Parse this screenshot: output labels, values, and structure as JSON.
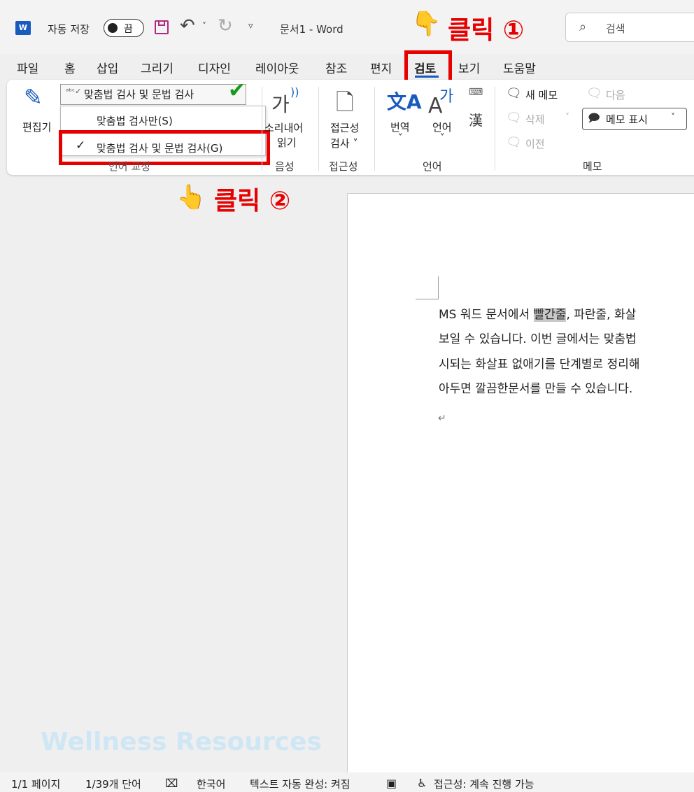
{
  "titlebar": {
    "app_icon": "W",
    "autosave_label": "자동 저장",
    "autosave_state": "끔",
    "doc_title": "문서1  -  Word",
    "search_placeholder": "검색"
  },
  "tabs": [
    "파일",
    "홈",
    "삽입",
    "그리기",
    "디자인",
    "레이아웃",
    "참조",
    "편지",
    "검토",
    "보기",
    "도움말"
  ],
  "active_tab": "검토",
  "ribbon": {
    "editor_label": "편집기",
    "spelling_combo": "맞춤법 검사 및 문법 검사",
    "menu_spelling_only": "맞춤법 검사만(S)",
    "menu_spelling_grammar": "맞춤법 검사 및 문법 검사(G)",
    "proofing_group": "언어 교정",
    "read_aloud_glyph": "가",
    "read_aloud_line1": "소리내어",
    "read_aloud_line2": "읽기",
    "speech_group": "음성",
    "accessibility_line1": "접근성",
    "accessibility_line2": "검사 ˅",
    "accessibility_group": "접근성",
    "translate_label": "번역",
    "translate_drop": "˅",
    "language_glyph": "가",
    "language_label": "언어",
    "language_drop": "˅",
    "hanja_label": "漢",
    "language_group": "언어",
    "new_comment": "새 메모",
    "delete_comment": "삭제",
    "previous_comment": "이전",
    "next_comment": "다음",
    "show_comments": "메모 표시",
    "comments_group": "메모"
  },
  "annotations": {
    "click1": "클릭 ①",
    "click2": "클릭 ②"
  },
  "document": {
    "line1_prefix": "MS 워드 문서에서 ",
    "line1_highlight": "빨간줄",
    "line1_suffix": ", 파란줄, 화살",
    "line2": "보일 수 있습니다. 이번 글에서는 맞춤법",
    "line3": "시되는 화살표 없애기를 단계별로 정리해",
    "line4": "아두면 깔끔한문서를 만들 수 있습니다.",
    "para_mark": "↵"
  },
  "watermark": "Wellness Resources",
  "statusbar": {
    "page": "1/1 페이지",
    "words": "1/39개 단어",
    "language": "한국어",
    "autocomplete": "텍스트 자동 완성: 켜짐",
    "accessibility": "접근성: 계속 진행 가능"
  },
  "colors": {
    "accent": "#185abd",
    "annotation_red": "#e60000",
    "check_green": "#1a9a1a"
  }
}
